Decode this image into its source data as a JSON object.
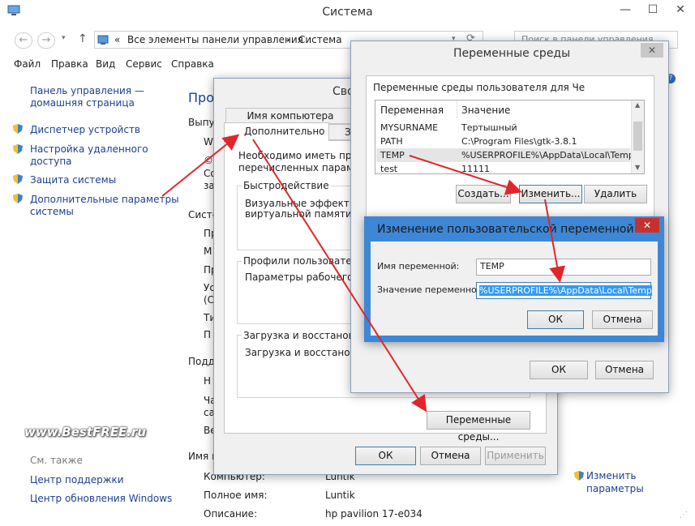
{
  "window": {
    "title": "Система",
    "minimize": "—",
    "maximize": "☐",
    "close": "✕"
  },
  "address": {
    "back": "←",
    "forward": "→",
    "up": "↑",
    "prefix": "«",
    "crumb_1": "Все элементы панели управления",
    "sep": "›",
    "crumb_2": "Система",
    "search_placeholder": "Поиск в панели управления"
  },
  "menubar": [
    "Файл",
    "Правка",
    "Вид",
    "Сервис",
    "Справка"
  ],
  "sidebar": {
    "home_line1": "Панель управления —",
    "home_line2": "домашняя страница",
    "items": [
      {
        "label": "Диспетчер устройств"
      },
      {
        "label1": "Настройка удаленного",
        "label2": "доступа"
      },
      {
        "label": "Защита системы"
      },
      {
        "label1": "Дополнительные параметры",
        "label2": "системы"
      }
    ],
    "see_also": "См. также",
    "support": "Центр поддержки",
    "update": "Центр обновления Windows"
  },
  "main": {
    "heading_partial": "Прос",
    "section_vyp": "Выпу",
    "w": "W",
    "c1": "©",
    "c2": "Со",
    "c3": "за",
    "section_sys": "Систе",
    "s1": "Пр",
    "s2": "М",
    "s3": "Пр",
    "s4": "Ус",
    "s5": "(С",
    "s6": "Ти",
    "s7": "П",
    "section_pod": "Подде",
    "p1": "Н",
    "p2": "Ча",
    "p3": "са",
    "p4": "Ве",
    "section_name": "Имя к",
    "computer_label": "Компьютер:",
    "computer_value": "Luntik",
    "fullname_label": "Полное имя:",
    "fullname_value": "Luntik",
    "desc_label": "Описание:",
    "desc_value": "hp pavilion 17-e034",
    "change_line1": "Изменить",
    "change_line2": "параметры",
    "watermark": "www.BestFREE.ru"
  },
  "sysprops": {
    "title_partial": "Сво",
    "tab_computer": "Имя компьютера",
    "tab_advanced": "Дополнительно",
    "tab_partial": "За",
    "info_line1": "Необходимо иметь права а",
    "info_line2": "перечисленных параметро",
    "perf_title": "Быстродействие",
    "perf_line1": "Визуальные эффекты, исп",
    "perf_line2": "виртуальной памяти",
    "profiles_title": "Профили пользователей",
    "profiles_line1": "Параметры рабочего стол",
    "startup_title": "Загрузка и восстановлени",
    "startup_line1": "Загрузка и восстановлени",
    "env_button": "Переменные среды...",
    "ok": "ОК",
    "cancel": "Отмена",
    "apply": "Применить"
  },
  "envvars": {
    "title": "Переменные среды",
    "close": "✕",
    "user_group": "Переменные среды пользователя для Че",
    "col_name": "Переменная",
    "col_value": "Значение",
    "rows": [
      {
        "name": "MYSURNAME",
        "value": "Тертышный"
      },
      {
        "name": "PATH",
        "value": "C:\\Program Files\\gtk-3.8.1"
      },
      {
        "name": "TEMP",
        "value": "%USERPROFILE%\\AppData\\Local\\Temp"
      },
      {
        "name": "test",
        "value": "11111"
      }
    ],
    "create": "Создать...",
    "edit": "Изменить...",
    "delete": "Удалить",
    "ok": "ОК",
    "cancel": "Отмена"
  },
  "editvar": {
    "title": "Изменение пользовательской переменной",
    "close": "✕",
    "name_label": "Имя переменной:",
    "name_value": "TEMP",
    "value_label": "Значение переменной:",
    "value_value": "%USERPROFILE%\\AppData\\Local\\Temp",
    "ok": "ОК",
    "cancel": "Отмена"
  },
  "colors": {
    "link": "#1c3f95",
    "arrow": "#e0262b",
    "edit_titlebar": "#3d87d6",
    "close_red": "#c7312d",
    "selection": "#3399ff"
  },
  "icons": {
    "app": "computer-icon",
    "shield": "uac-shield-icon",
    "help": "help-icon",
    "refresh": "refresh-icon",
    "search": "search-icon",
    "address": "control-panel-icon"
  }
}
